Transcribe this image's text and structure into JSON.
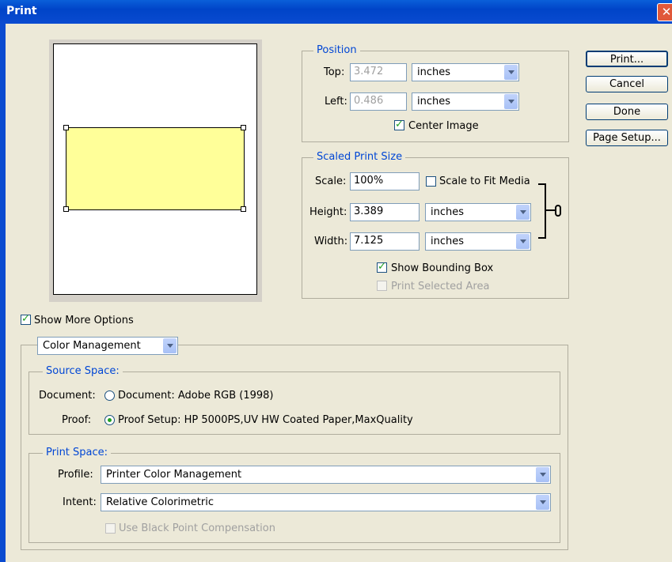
{
  "window": {
    "title": "Print"
  },
  "buttons": {
    "print": "Print...",
    "cancel": "Cancel",
    "done": "Done",
    "page_setup": "Page Setup..."
  },
  "position": {
    "legend": "Position",
    "top_label": "Top:",
    "top_value": "3.472",
    "top_unit": "inches",
    "left_label": "Left:",
    "left_value": "0.486",
    "left_unit": "inches",
    "center_image_label": "Center Image",
    "center_image_checked": true
  },
  "scaled": {
    "legend": "Scaled Print Size",
    "scale_label": "Scale:",
    "scale_value": "100%",
    "scale_to_fit_label": "Scale to Fit Media",
    "scale_to_fit_checked": false,
    "height_label": "Height:",
    "height_value": "3.389",
    "height_unit": "inches",
    "width_label": "Width:",
    "width_value": "7.125",
    "width_unit": "inches",
    "show_bbox_label": "Show Bounding Box",
    "show_bbox_checked": true,
    "print_selected_label": "Print Selected Area",
    "print_selected_checked": false
  },
  "show_more_options": {
    "label": "Show More Options",
    "checked": true
  },
  "options_combo": {
    "value": "Color Management"
  },
  "source_space": {
    "legend": "Source Space:",
    "document_label": "Document:",
    "document_radio_label": "Document:  Adobe RGB (1998)",
    "document_selected": false,
    "proof_label": "Proof:",
    "proof_radio_label": "Proof Setup:  HP 5000PS,UV HW Coated Paper,MaxQuality",
    "proof_selected": true
  },
  "print_space": {
    "legend": "Print Space:",
    "profile_label": "Profile:",
    "profile_value": "Printer Color Management",
    "intent_label": "Intent:",
    "intent_value": "Relative Colorimetric",
    "black_point_label": "Use Black Point Compensation",
    "black_point_checked": false
  },
  "icons": {
    "close": "close-icon",
    "link": "link-icon",
    "dropdown": "chevron-down-icon"
  }
}
